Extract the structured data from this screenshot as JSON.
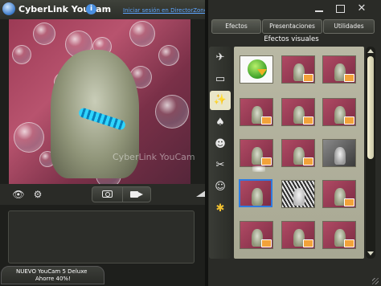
{
  "app": {
    "title": "CyberLink YouCam",
    "info_label": "i",
    "login_link": "Iniciar sesión en DirectorZone"
  },
  "preview": {
    "watermark": "CyberLink YouCam"
  },
  "controls": {
    "eye_icon": "eye-icon",
    "settings_icon": "gear-icon",
    "snap_icon": "camera-icon",
    "record_icon": "video-camera-icon",
    "zoom_icon": "zoom-triangle-icon"
  },
  "promo": {
    "line1": "NUEVO YouCam 5 Deluxe",
    "line2": "Ahorre 40%!"
  },
  "window_controls": {
    "minimize": "minimize-icon",
    "maximize": "maximize-icon",
    "close": "✕"
  },
  "tabs": [
    {
      "label": "Efectos",
      "selected": true
    },
    {
      "label": "Presentaciones",
      "selected": false
    },
    {
      "label": "Utilidades",
      "selected": false
    }
  ],
  "section_title": "Efectos visuales",
  "sidebar_icons": [
    {
      "name": "scene-icon",
      "glyph": "✈",
      "selected": false
    },
    {
      "name": "frame-icon",
      "glyph": "▭",
      "selected": false
    },
    {
      "name": "particle-icon",
      "glyph": "✨",
      "selected": true
    },
    {
      "name": "mask-icon",
      "glyph": "♠",
      "selected": false
    },
    {
      "name": "avatar-icon",
      "glyph": "☻",
      "selected": false
    },
    {
      "name": "distortion-icon",
      "glyph": "✂",
      "selected": false
    },
    {
      "name": "emotion-icon",
      "glyph": "☺",
      "selected": false
    },
    {
      "name": "gadget-icon",
      "glyph": "✱",
      "selected": false
    }
  ],
  "effects": {
    "download_icon": "download-globe-icon",
    "selected_thumbnail": "row-4-col-1",
    "badge_color": "#f2a23a",
    "selection_color": "#2e7ae0"
  },
  "colors": {
    "accent": "#2e7ae0",
    "link": "#5ea6ff",
    "panel": "#2a2b27"
  }
}
